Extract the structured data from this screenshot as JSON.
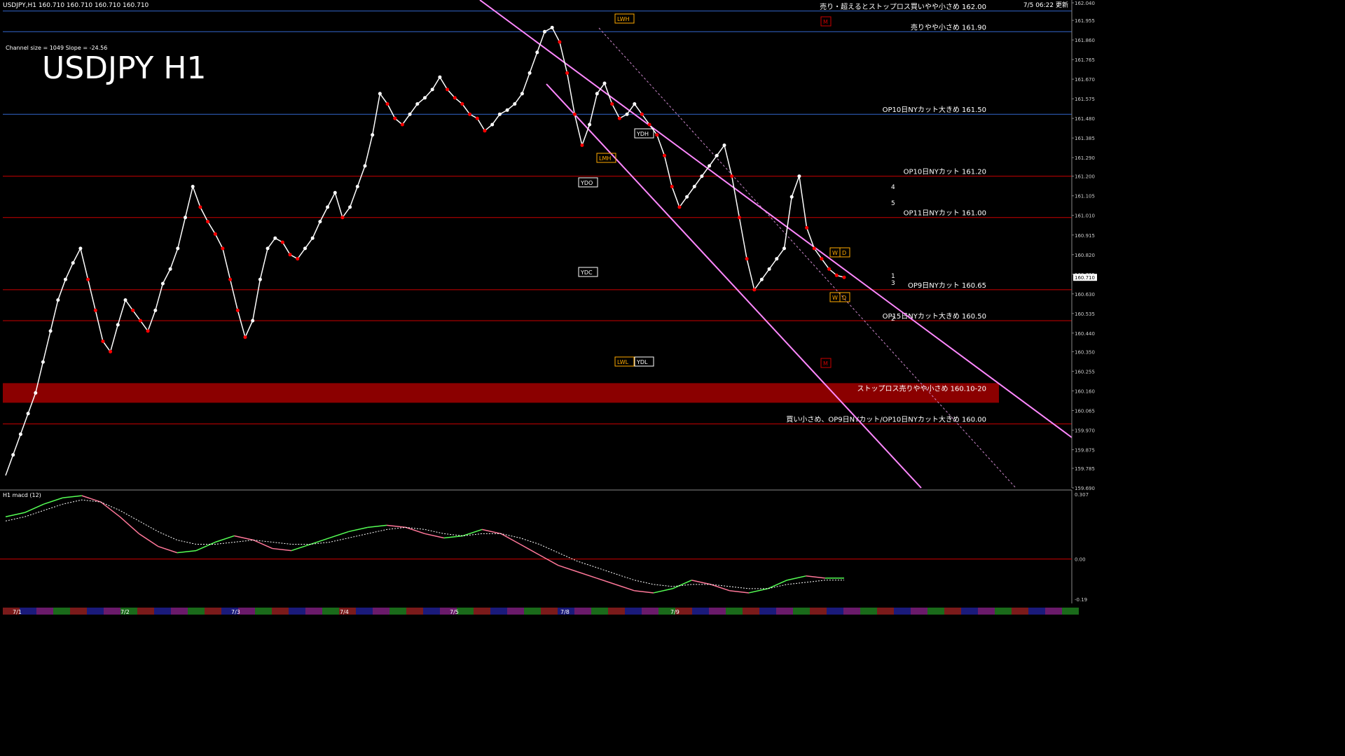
{
  "window": {
    "title": "USDJPY,H1  160.710 160.710 160.710 160.710",
    "updated": "7/5 06:22 更新",
    "big_label": "USDJPY H1",
    "channel_info": "Channel size = 1049 Slope = -24.56"
  },
  "colors": {
    "bg": "#000000",
    "up": "#ffffff",
    "down": "#ff0000",
    "fast_ma": "#ffffff",
    "mid_ma": "#ffff00",
    "slow_ma": "#0000ff",
    "chikou": "#00bb00",
    "channel": "#ff88ff",
    "level_blue": "#3366cc",
    "level_red": "#cc0000",
    "macd": "#55ff55",
    "macd_neg": "#ff7799",
    "signal": "#ffffff"
  },
  "chart_data": [
    {
      "type": "line",
      "title": "USDJPY H1",
      "ylim": [
        159.69,
        162.04
      ],
      "y_ticks": [
        "162.040",
        "161.955",
        "161.860",
        "161.765",
        "161.670",
        "161.575",
        "161.480",
        "161.385",
        "161.290",
        "161.200",
        "161.105",
        "161.010",
        "160.915",
        "160.820",
        "160.725",
        "160.630",
        "160.535",
        "160.440",
        "160.350",
        "160.255",
        "160.160",
        "160.065",
        "159.970",
        "159.875",
        "159.785",
        "159.690"
      ],
      "x_labels": [
        "7/1",
        "7/2",
        "7/3",
        "7/4",
        "7/5",
        "7/8",
        "7/9"
      ],
      "last_price": "160.710",
      "series": [
        {
          "values": [
            159.75,
            159.85,
            159.95,
            160.05,
            160.15,
            160.3,
            160.45,
            160.6,
            160.7,
            160.78,
            160.85,
            160.7,
            160.55,
            160.4,
            160.35,
            160.48,
            160.6,
            160.55,
            160.5,
            160.45,
            160.55,
            160.68,
            160.75,
            160.85,
            161.0,
            161.15,
            161.05,
            160.98,
            160.92,
            160.85,
            160.7,
            160.55,
            160.42,
            160.5,
            160.7,
            160.85,
            160.9,
            160.88,
            160.82,
            160.8,
            160.85,
            160.9,
            160.98,
            161.05,
            161.12,
            161.0,
            161.05,
            161.15,
            161.25,
            161.4,
            161.6,
            161.55,
            161.48,
            161.45,
            161.5,
            161.55,
            161.58,
            161.62,
            161.68,
            161.62,
            161.58,
            161.55,
            161.5,
            161.48,
            161.42,
            161.45,
            161.5,
            161.52,
            161.55,
            161.6,
            161.7,
            161.8,
            161.9,
            161.92,
            161.85,
            161.7,
            161.5,
            161.35,
            161.45,
            161.6,
            161.65,
            161.55,
            161.48,
            161.5,
            161.55,
            161.5,
            161.45,
            161.4,
            161.3,
            161.15,
            161.05,
            161.1,
            161.15,
            161.2,
            161.25,
            161.3,
            161.35,
            161.2,
            161.0,
            160.8,
            160.65,
            160.7,
            160.75,
            160.8,
            160.85,
            161.1,
            161.2,
            160.95,
            160.85,
            160.8,
            160.75,
            160.72,
            160.71
          ]
        }
      ],
      "levels": [
        {
          "text": "売り・超えるとストップロス買いやや小さめ 162.00",
          "price": 162.0,
          "color": "#3366cc"
        },
        {
          "text": "売りやや小さめ 161.90",
          "price": 161.9,
          "color": "#3366cc"
        },
        {
          "text": "OP10日NYカット大きめ 161.50",
          "price": 161.5,
          "color": "#3366cc"
        },
        {
          "text": "OP10日NYカット 161.20",
          "price": 161.2,
          "color": "#cc0000"
        },
        {
          "text": "OP11日NYカット 161.00",
          "price": 161.0,
          "color": "#cc0000"
        },
        {
          "text": "OP9日NYカット 160.65",
          "price": 160.65,
          "color": "#cc0000"
        },
        {
          "text": "OP15日NYカット大きめ 160.50",
          "price": 160.5,
          "color": "#cc0000"
        },
        {
          "text": "ストップロス売りやや小さめ 160.10-20",
          "price": 160.15,
          "color": "#8b0000"
        },
        {
          "text": "買い小さめ、OP9日NYカット/OP10日NYカット大きめ 160.00",
          "price": 160.0,
          "color": "#cc0000"
        }
      ],
      "markers": [
        "LWH",
        "M",
        "YDH",
        "LMH",
        "YDO",
        "YDC",
        "W",
        "D",
        "LWL",
        "YDL",
        "M",
        "W",
        "D"
      ],
      "projection_labels": [
        "1",
        "2",
        "3",
        "4",
        "5"
      ]
    },
    {
      "type": "line",
      "title": "H1  macd (12)",
      "ylim": [
        -0.19,
        0.307
      ],
      "y_ticks": [
        "0.307",
        "0.00",
        "-0.19"
      ],
      "series": [
        {
          "values": [
            0.2,
            0.22,
            0.26,
            0.29,
            0.3,
            0.27,
            0.2,
            0.12,
            0.06,
            0.03,
            0.04,
            0.08,
            0.11,
            0.09,
            0.05,
            0.04,
            0.07,
            0.1,
            0.13,
            0.15,
            0.16,
            0.15,
            0.12,
            0.1,
            0.11,
            0.14,
            0.12,
            0.07,
            0.02,
            -0.03,
            -0.06,
            -0.09,
            -0.12,
            -0.15,
            -0.16,
            -0.14,
            -0.1,
            -0.12,
            -0.15,
            -0.16,
            -0.14,
            -0.1,
            -0.08,
            -0.09,
            -0.09
          ]
        },
        {
          "values": [
            0.18,
            0.2,
            0.23,
            0.26,
            0.28,
            0.27,
            0.23,
            0.18,
            0.13,
            0.09,
            0.07,
            0.07,
            0.08,
            0.09,
            0.08,
            0.07,
            0.07,
            0.08,
            0.1,
            0.12,
            0.14,
            0.15,
            0.14,
            0.12,
            0.11,
            0.12,
            0.12,
            0.1,
            0.07,
            0.03,
            -0.01,
            -0.04,
            -0.07,
            -0.1,
            -0.12,
            -0.13,
            -0.12,
            -0.12,
            -0.13,
            -0.14,
            -0.14,
            -0.12,
            -0.11,
            -0.1,
            -0.1
          ]
        }
      ]
    }
  ]
}
